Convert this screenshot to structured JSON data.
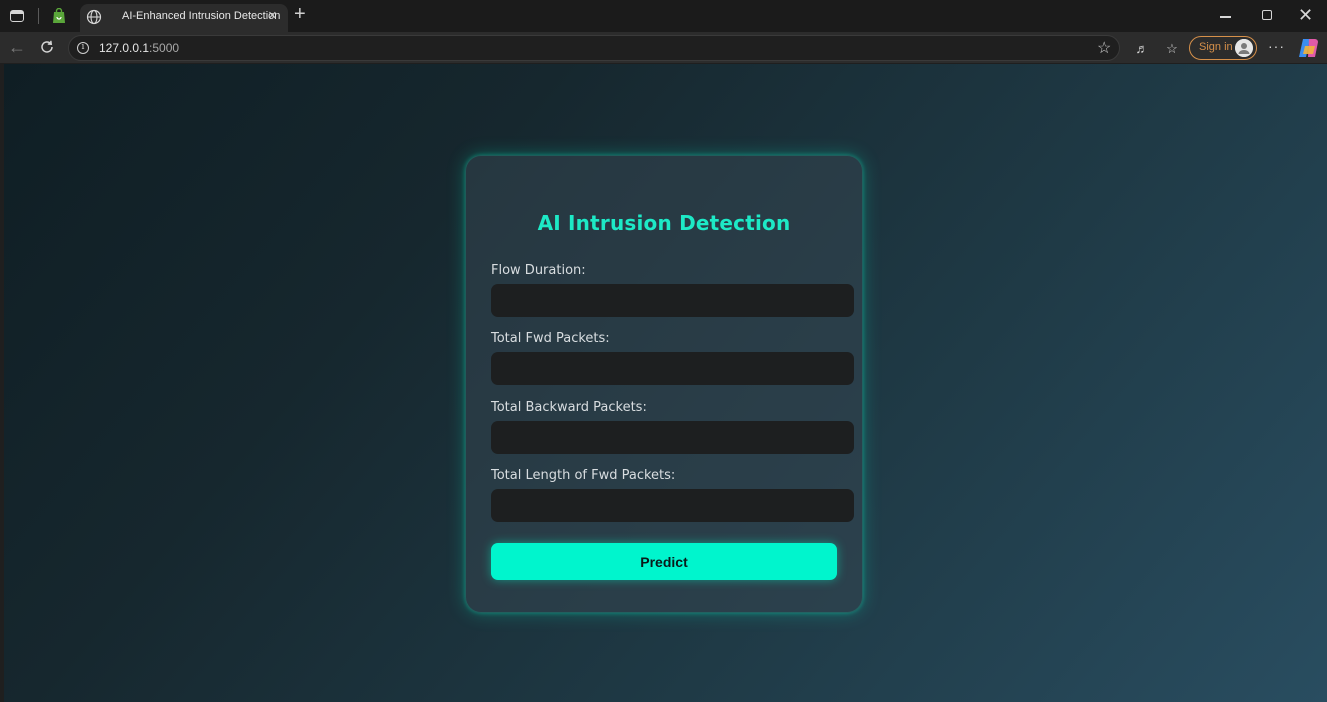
{
  "browser": {
    "tab_title": "AI-Enhanced Intrusion Detection",
    "tab_close": "×",
    "new_tab": "+",
    "url_host": "127.0.0.1",
    "url_port": ":5000",
    "sign_in_label": "Sign in",
    "more_label": "···",
    "window_close": "✕"
  },
  "page": {
    "title": "AI Intrusion Detection",
    "fields": [
      {
        "label": "Flow Duration:",
        "value": ""
      },
      {
        "label": "Total Fwd Packets:",
        "value": ""
      },
      {
        "label": "Total Backward Packets:",
        "value": ""
      },
      {
        "label": "Total Length of Fwd Packets:",
        "value": ""
      }
    ],
    "submit_label": "Predict"
  },
  "colors": {
    "accent": "#00f5cd",
    "title": "#1de9c6",
    "input_bg": "#1d1f20"
  }
}
